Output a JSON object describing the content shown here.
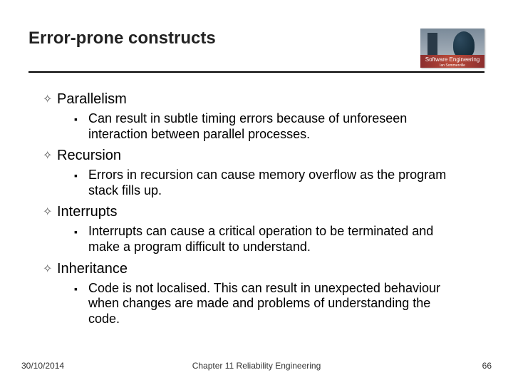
{
  "title": "Error-prone constructs",
  "logo": {
    "text": "Software Engineering",
    "sub": "Ian Sommerville"
  },
  "items": [
    {
      "heading": "Parallelism",
      "sub": "Can result in subtle timing errors because of unforeseen interaction between parallel processes."
    },
    {
      "heading": "Recursion",
      "sub": "Errors in recursion can cause memory overflow as the program stack fills up."
    },
    {
      "heading": "Interrupts",
      "sub": "Interrupts can cause a critical operation to be terminated and make a program difficult to understand."
    },
    {
      "heading": "Inheritance",
      "sub": "Code is not localised. This can result in unexpected behaviour when changes are made and problems of understanding the code."
    }
  ],
  "footer": {
    "date": "30/10/2014",
    "center": "Chapter 11 Reliability Engineering",
    "page": "66"
  }
}
